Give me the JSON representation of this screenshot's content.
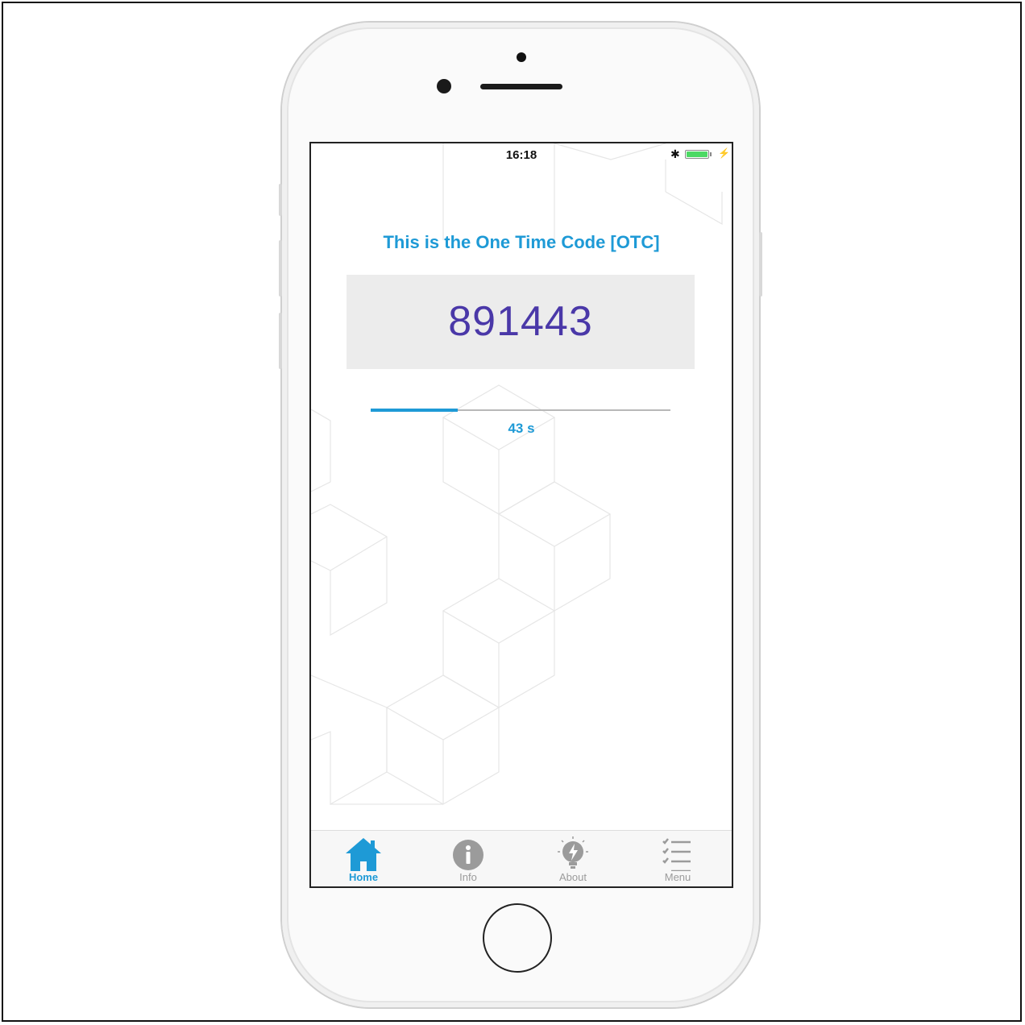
{
  "status_bar": {
    "time": "16:18",
    "bluetooth_icon": "bluetooth-icon",
    "battery_icon": "battery-icon",
    "charging_icon": "charging-icon"
  },
  "otc": {
    "title": "This is the One Time Code [OTC]",
    "code": "891443",
    "countdown": "43 s",
    "progress_fraction": 0.29
  },
  "tabbar": {
    "tabs": [
      {
        "label": "Home",
        "icon": "home-icon",
        "active": true
      },
      {
        "label": "Info",
        "icon": "info-icon",
        "active": false
      },
      {
        "label": "About",
        "icon": "lightbulb-icon",
        "active": false
      },
      {
        "label": "Menu",
        "icon": "checklist-icon",
        "active": false
      }
    ]
  },
  "colors": {
    "accent": "#1e9ad6",
    "code_text": "#4a38a8",
    "code_box": "#ececec",
    "inactive_tab": "#9b9b9b"
  }
}
